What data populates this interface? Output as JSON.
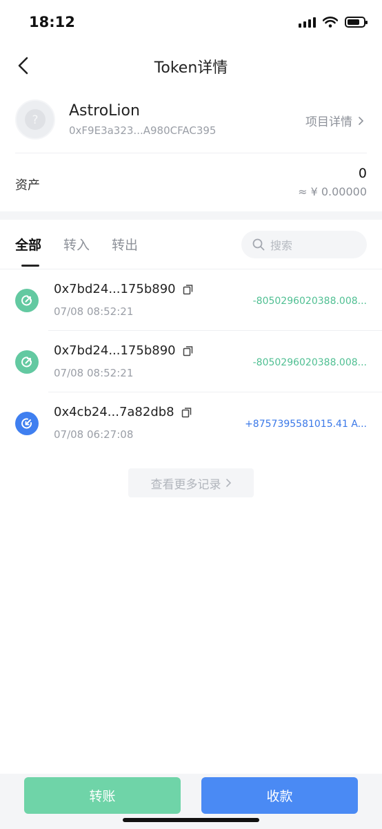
{
  "status_bar": {
    "time": "18:12"
  },
  "nav": {
    "title": "Token详情",
    "back_icon": "chevron-left-icon"
  },
  "token": {
    "name": "AstroLion",
    "address": "0xF9E3a323...A980CFAC395",
    "project_link": "项目详情"
  },
  "assets": {
    "label": "资产",
    "amount": "0",
    "fiat": "≈ ¥ 0.00000"
  },
  "tabs": [
    {
      "label": "全部",
      "active": true
    },
    {
      "label": "转入",
      "active": false
    },
    {
      "label": "转出",
      "active": false
    }
  ],
  "search": {
    "placeholder": "搜索"
  },
  "transactions": [
    {
      "hash": "0x7bd24...175b890",
      "time": "07/08 08:52:21",
      "amount": "-8050296020388.008...",
      "direction": "out"
    },
    {
      "hash": "0x7bd24...175b890",
      "time": "07/08 08:52:21",
      "amount": "-8050296020388.008...",
      "direction": "out"
    },
    {
      "hash": "0x4cb24...7a82db8",
      "time": "07/08 06:27:08",
      "amount": "+8757395581015.41 A...",
      "direction": "in"
    }
  ],
  "more_records": "查看更多记录",
  "bottom": {
    "transfer_label": "转账",
    "receive_label": "收款"
  },
  "colors": {
    "out": "#4fbf92",
    "in": "#3a78e8",
    "transfer_button": "#6fd4a8",
    "receive_button": "#4a8af4"
  }
}
